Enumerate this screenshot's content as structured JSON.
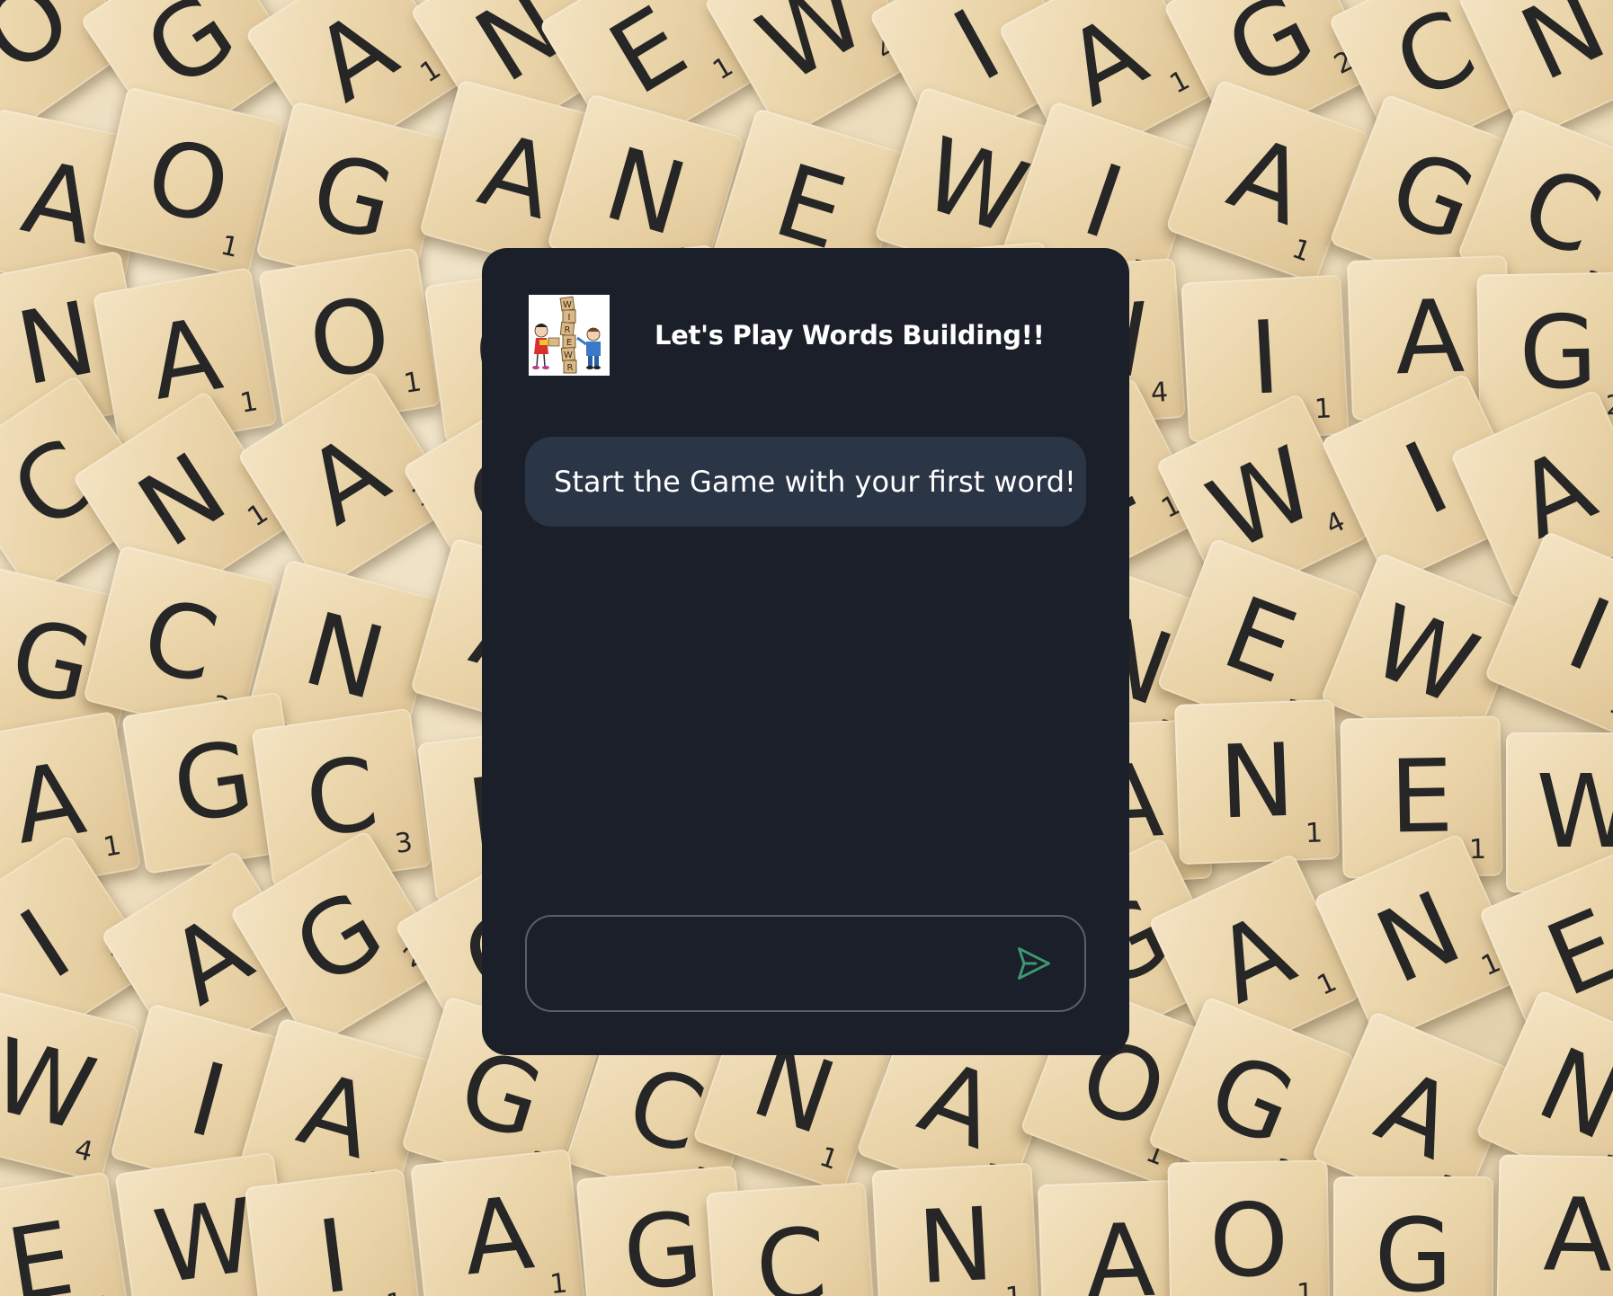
{
  "app": {
    "title": "Let's Play Words Building!!",
    "logo_icon": "kids-building-word-tiles-icon",
    "logo_letters": [
      "W",
      "I",
      "R",
      "E",
      "W",
      "R"
    ]
  },
  "chat": {
    "messages": [
      {
        "text": "Start the Game with your first word!"
      }
    ]
  },
  "composer": {
    "value": "",
    "placeholder": "",
    "send_icon": "send-icon"
  },
  "background": {
    "tiles": [
      {
        "letter": "O",
        "points": "1"
      },
      {
        "letter": "G",
        "points": "2"
      },
      {
        "letter": "A",
        "points": "1"
      },
      {
        "letter": "N",
        "points": "1"
      },
      {
        "letter": "E",
        "points": "1"
      },
      {
        "letter": "W",
        "points": "4"
      },
      {
        "letter": "I",
        "points": "1"
      },
      {
        "letter": "A",
        "points": "1"
      },
      {
        "letter": "G",
        "points": "2"
      },
      {
        "letter": "C",
        "points": "3"
      },
      {
        "letter": "N",
        "points": "1"
      },
      {
        "letter": "A",
        "points": "1"
      }
    ]
  },
  "colors": {
    "card_bg": "#1a1f29",
    "bubble_bg": "#2a3545",
    "input_border": "#556070",
    "send_accent": "#3d9970"
  }
}
